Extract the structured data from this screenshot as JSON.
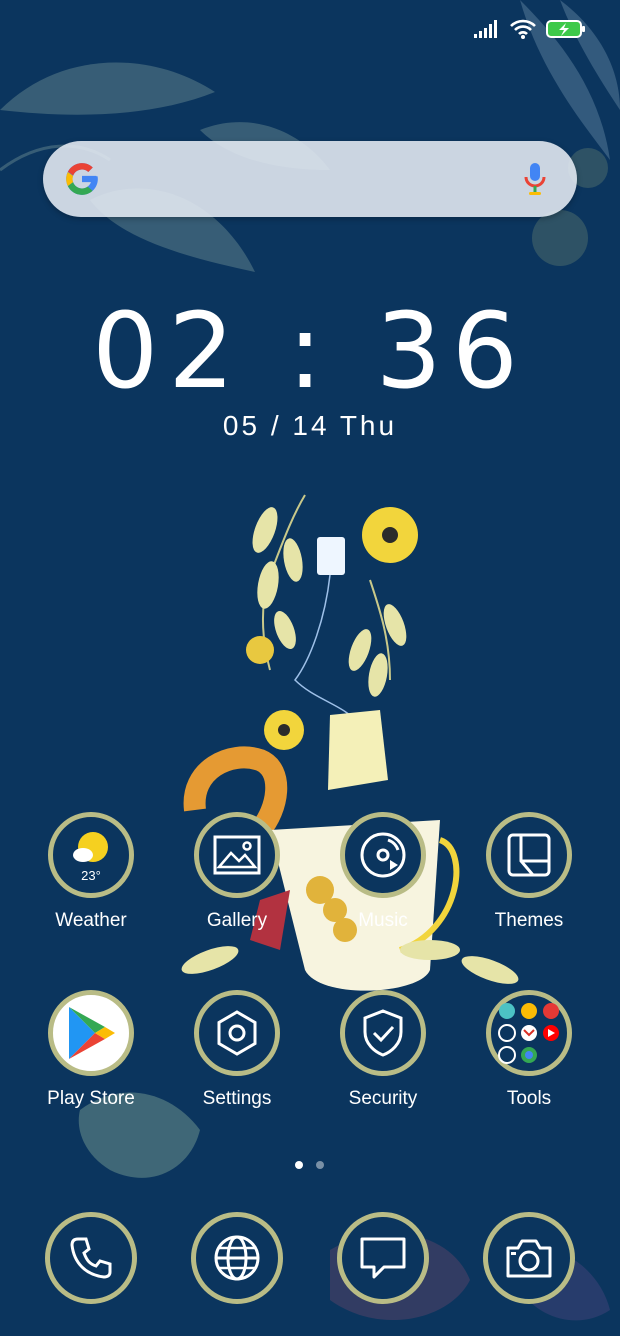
{
  "status_bar": {
    "signal_icon": "signal-bars-icon",
    "wifi_icon": "wifi-icon",
    "battery_icon": "battery-charging-icon",
    "battery_color": "#3ec94a"
  },
  "search": {
    "logo": "google-g-icon",
    "mic": "mic-icon"
  },
  "clock": {
    "time": "02 : 36",
    "date": "05 / 14   Thu"
  },
  "apps_row1": [
    {
      "label": "Weather",
      "icon": "weather-icon",
      "temp": "23°"
    },
    {
      "label": "Gallery",
      "icon": "gallery-icon"
    },
    {
      "label": "Music",
      "icon": "music-icon"
    },
    {
      "label": "Themes",
      "icon": "themes-icon"
    }
  ],
  "apps_row2": [
    {
      "label": "Play Store",
      "icon": "play-store-icon"
    },
    {
      "label": "Settings",
      "icon": "settings-icon"
    },
    {
      "label": "Security",
      "icon": "security-icon"
    },
    {
      "label": "Tools",
      "icon": "folder-icon"
    }
  ],
  "dock": [
    {
      "icon": "phone-icon"
    },
    {
      "icon": "browser-globe-icon"
    },
    {
      "icon": "messages-icon"
    },
    {
      "icon": "camera-icon"
    }
  ],
  "pager": {
    "pages": 2,
    "current": 1
  },
  "colors": {
    "background": "#0b355e",
    "ring": "#b9bc86",
    "accent_yellow": "#f2d53c"
  }
}
